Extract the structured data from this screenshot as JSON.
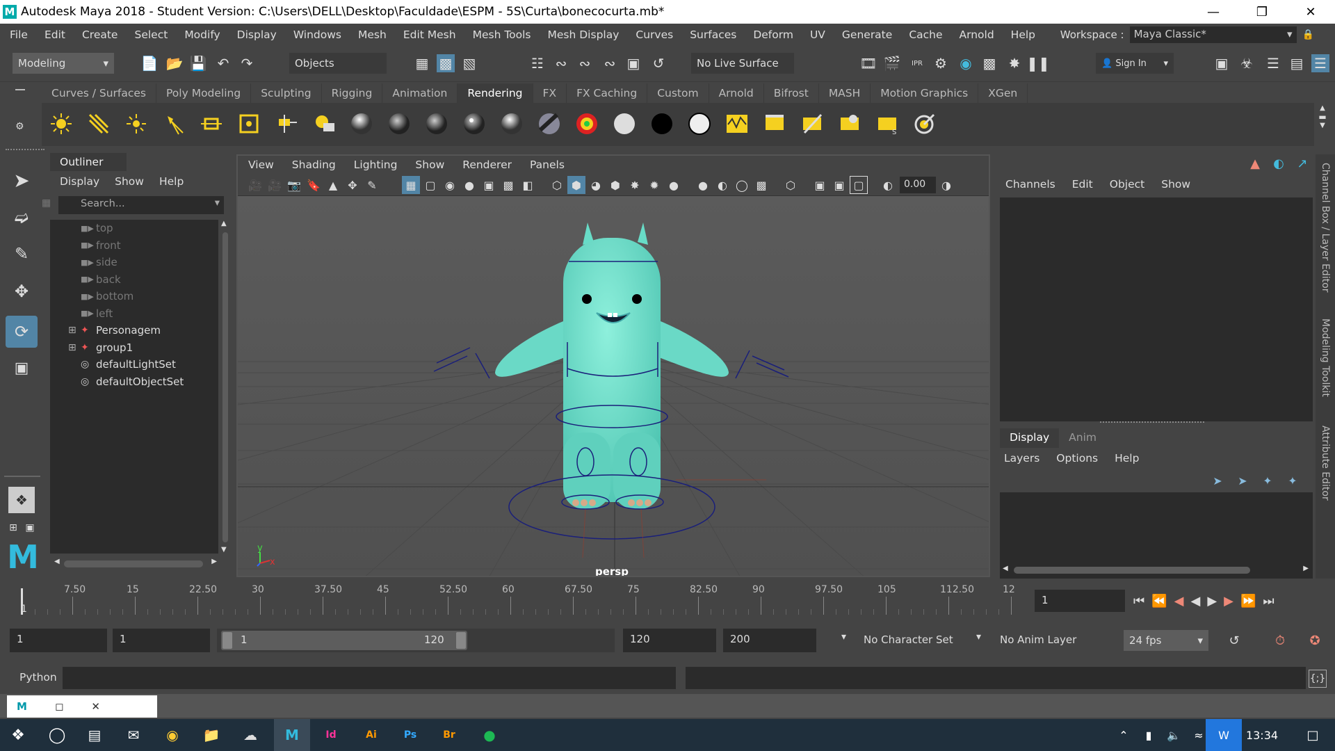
{
  "window": {
    "title": "Autodesk Maya 2018 - Student Version: C:\\Users\\DELL\\Desktop\\Faculdade\\ESPM - 5S\\Curta\\bonecocurta.mb*",
    "logo": "M"
  },
  "menubar": {
    "items": [
      "File",
      "Edit",
      "Create",
      "Select",
      "Modify",
      "Display",
      "Windows",
      "Mesh",
      "Edit Mesh",
      "Mesh Tools",
      "Mesh Display",
      "Curves",
      "Surfaces",
      "Deform",
      "UV",
      "Generate",
      "Cache",
      "Arnold",
      "Help"
    ],
    "workspace_label": "Workspace :",
    "workspace_value": "Maya Classic*"
  },
  "statusline": {
    "mode": "Modeling",
    "objects": "Objects",
    "live_surface": "No Live Surface",
    "sign_in": "Sign In"
  },
  "shelf": {
    "tabs": [
      "Curves / Surfaces",
      "Poly Modeling",
      "Sculpting",
      "Rigging",
      "Animation",
      "Rendering",
      "FX",
      "FX Caching",
      "Custom",
      "Arnold",
      "Bifrost",
      "MASH",
      "Motion Graphics",
      "XGen"
    ],
    "active": "Rendering"
  },
  "outliner": {
    "title": "Outliner",
    "menu": [
      "Display",
      "Show",
      "Help"
    ],
    "search_placeholder": "Search...",
    "items": [
      {
        "label": "top",
        "icon": "camera-icon",
        "dim": true
      },
      {
        "label": "front",
        "icon": "camera-icon",
        "dim": true
      },
      {
        "label": "side",
        "icon": "camera-icon",
        "dim": true
      },
      {
        "label": "back",
        "icon": "camera-icon",
        "dim": true
      },
      {
        "label": "bottom",
        "icon": "camera-icon",
        "dim": true
      },
      {
        "label": "left",
        "icon": "camera-icon",
        "dim": true
      },
      {
        "label": "Personagem",
        "icon": "group-icon",
        "dim": false,
        "expandable": true
      },
      {
        "label": "group1",
        "icon": "group-icon",
        "dim": false,
        "expandable": true
      },
      {
        "label": "defaultLightSet",
        "icon": "set-icon",
        "dim": false
      },
      {
        "label": "defaultObjectSet",
        "icon": "set-icon",
        "dim": false
      }
    ]
  },
  "viewport": {
    "menu": [
      "View",
      "Shading",
      "Lighting",
      "Show",
      "Renderer",
      "Panels"
    ],
    "exposure": "0.00",
    "camera_label": "persp",
    "axis_y": "y",
    "axis_x": "x"
  },
  "channelbox": {
    "menu": [
      "Channels",
      "Edit",
      "Object",
      "Show"
    ],
    "tabs": [
      "Display",
      "Anim"
    ],
    "layer_menu": [
      "Layers",
      "Options",
      "Help"
    ],
    "side_tabs": [
      "Channel Box / Layer Editor",
      "Modeling Toolkit",
      "Attribute Editor"
    ]
  },
  "timeline": {
    "ticks": [
      "7.50",
      "15",
      "22.50",
      "30",
      "37.50",
      "45",
      "52.50",
      "60",
      "67.50",
      "75",
      "82.50",
      "90",
      "97.50",
      "105",
      "112.50",
      "12"
    ],
    "start_label": "1",
    "current_frame": "1"
  },
  "range": {
    "start": "1",
    "playback_start": "1",
    "slider_start": "1",
    "slider_end": "120",
    "playback_end": "120",
    "end": "200",
    "character_set": "No Character Set",
    "anim_layer": "No Anim Layer",
    "fps": "24 fps"
  },
  "cmdline": {
    "lang": "Python"
  },
  "taskbar": {
    "time": "13:34"
  }
}
